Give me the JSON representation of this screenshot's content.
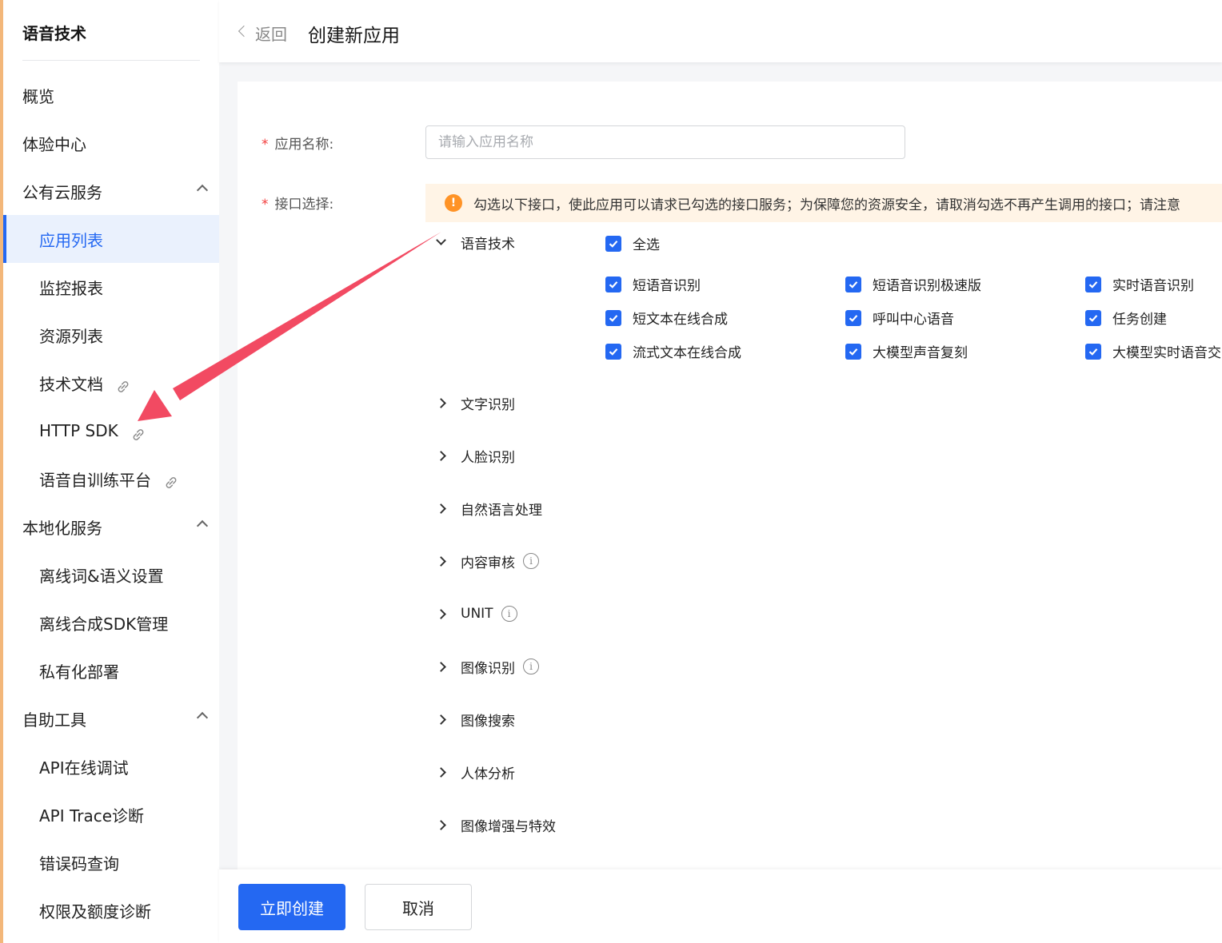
{
  "sidebar": {
    "title": "语音技术",
    "items": [
      {
        "label": "概览"
      },
      {
        "label": "体验中心"
      },
      {
        "label": "公有云服务"
      },
      {
        "label": "应用列表"
      },
      {
        "label": "监控报表"
      },
      {
        "label": "资源列表"
      },
      {
        "label": "技术文档"
      },
      {
        "label": "HTTP SDK"
      },
      {
        "label": "语音自训练平台"
      },
      {
        "label": "本地化服务"
      },
      {
        "label": "离线词&语义设置"
      },
      {
        "label": "离线合成SDK管理"
      },
      {
        "label": "私有化部署"
      },
      {
        "label": "自助工具"
      },
      {
        "label": "API在线调试"
      },
      {
        "label": "API Trace诊断"
      },
      {
        "label": "错误码查询"
      },
      {
        "label": "权限及额度诊断"
      }
    ]
  },
  "header": {
    "back_label": "返回",
    "title": "创建新应用"
  },
  "form": {
    "app_name_label": "应用名称:",
    "app_name_placeholder": "请输入应用名称",
    "app_name_value": "",
    "api_select_label": "接口选择:",
    "notice": "勾选以下接口，使此应用可以请求已勾选的接口服务；为保障您的资源安全，请取消勾选不再产生调用的接口；请注意",
    "expanded_category": "语音技术",
    "select_all": "全选",
    "apis": [
      {
        "label": "短语音识别",
        "checked": true
      },
      {
        "label": "短语音识别极速版",
        "checked": true
      },
      {
        "label": "实时语音识别",
        "checked": true
      },
      {
        "label": "短文本在线合成",
        "checked": true
      },
      {
        "label": "呼叫中心语音",
        "checked": true
      },
      {
        "label": "任务创建",
        "checked": true
      },
      {
        "label": "流式文本在线合成",
        "checked": true
      },
      {
        "label": "大模型声音复刻",
        "checked": true
      },
      {
        "label": "大模型实时语音交",
        "checked": true
      }
    ],
    "categories": [
      {
        "label": "文字识别"
      },
      {
        "label": "人脸识别"
      },
      {
        "label": "自然语言处理"
      },
      {
        "label": "内容审核"
      },
      {
        "label": "UNIT"
      },
      {
        "label": "图像识别"
      },
      {
        "label": "图像搜索"
      },
      {
        "label": "人体分析"
      },
      {
        "label": "图像增强与特效"
      }
    ]
  },
  "footer": {
    "create_label": "立即创建",
    "cancel_label": "取消"
  },
  "colors": {
    "accent": "#2468f2",
    "annotation_arrow": "#f24a62",
    "warning": "#ff9326"
  }
}
